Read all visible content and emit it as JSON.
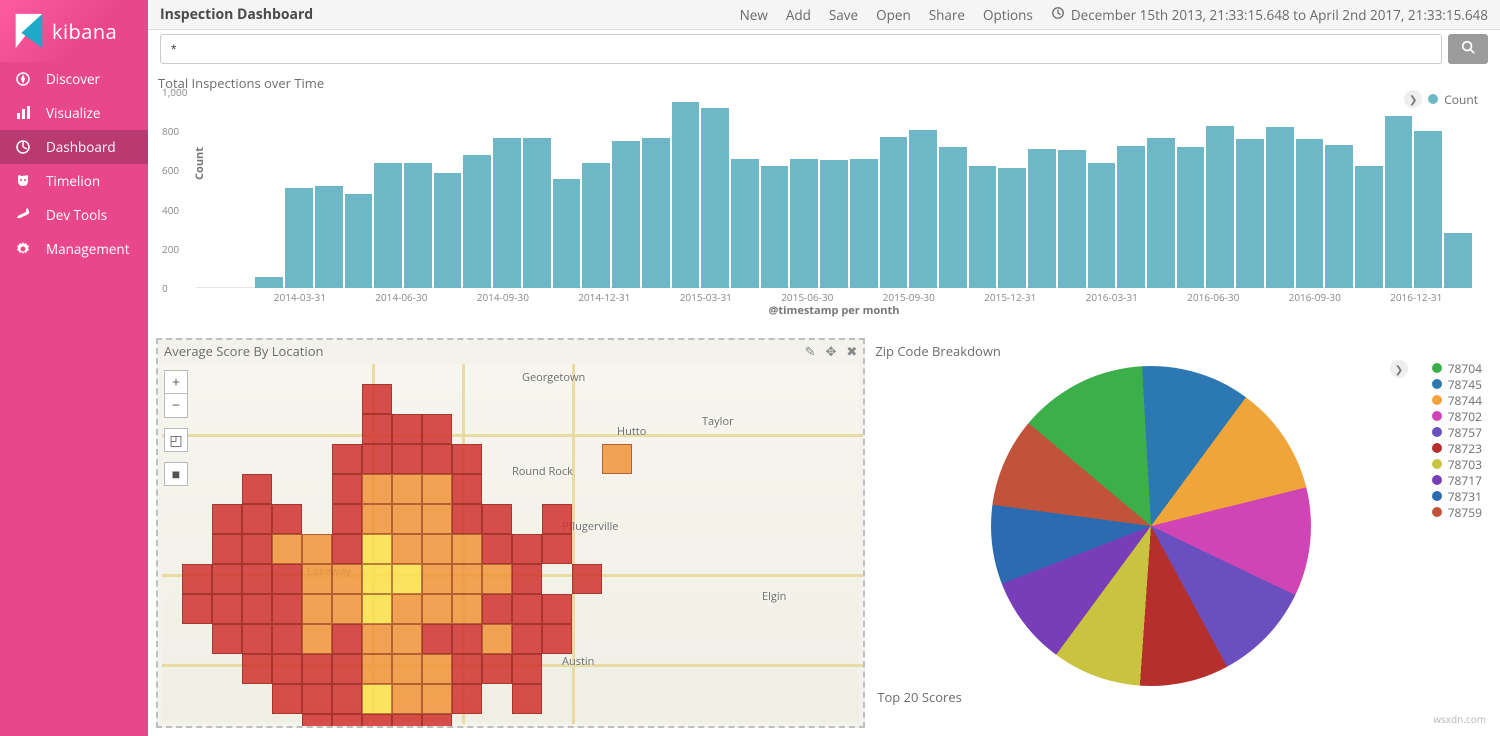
{
  "brand": "kibana",
  "nav": [
    {
      "label": "Discover",
      "active": false
    },
    {
      "label": "Visualize",
      "active": false
    },
    {
      "label": "Dashboard",
      "active": true
    },
    {
      "label": "Timelion",
      "active": false
    },
    {
      "label": "Dev Tools",
      "active": false
    },
    {
      "label": "Management",
      "active": false
    }
  ],
  "topbar": {
    "title": "Inspection Dashboard",
    "actions": [
      "New",
      "Add",
      "Save",
      "Open",
      "Share",
      "Options"
    ],
    "timerange": "December 15th 2013, 21:33:15.648 to April 2nd 2017, 21:33:15.648"
  },
  "search": {
    "value": "*"
  },
  "panels": {
    "bar_title": "Total Inspections over Time",
    "bar_legend": "Count",
    "map_title": "Average Score By Location",
    "pie_title": "Zip Code Breakdown",
    "scores_title": "Top 20 Scores"
  },
  "map_labels": [
    "Georgetown",
    "Round Rock",
    "Hutto",
    "Taylor",
    "Pflugerville",
    "Elgin",
    "Lakeway",
    "Austin"
  ],
  "pie_legend": [
    {
      "label": "78704",
      "color": "#3caf4a"
    },
    {
      "label": "78745",
      "color": "#2b78b3"
    },
    {
      "label": "78744",
      "color": "#f0a53a"
    },
    {
      "label": "78702",
      "color": "#d045b5"
    },
    {
      "label": "78757",
      "color": "#6a4fbf"
    },
    {
      "label": "78723",
      "color": "#b5302d"
    },
    {
      "label": "78703",
      "color": "#c9c33f"
    },
    {
      "label": "78717",
      "color": "#7a3db8"
    },
    {
      "label": "78731",
      "color": "#2d6bb0"
    },
    {
      "label": "78759",
      "color": "#c1533a"
    }
  ],
  "watermark": "wsxdn.com",
  "chart_data": [
    {
      "type": "bar",
      "title": "Total Inspections over Time",
      "xlabel": "@timestamp per month",
      "ylabel": "Count",
      "ylim": [
        0,
        1000
      ],
      "yticks": [
        0,
        200,
        400,
        600,
        800,
        "1,000"
      ],
      "xticks": [
        "2014-03-31",
        "2014-06-30",
        "2014-09-30",
        "2014-12-31",
        "2015-03-31",
        "2015-06-30",
        "2015-09-30",
        "2015-12-31",
        "2016-03-31",
        "2016-06-30",
        "2016-09-30",
        "2016-12-31"
      ],
      "series": [
        {
          "name": "Count",
          "color": "#6db7c6",
          "values": [
            0,
            0,
            55,
            510,
            520,
            480,
            640,
            640,
            585,
            680,
            765,
            765,
            555,
            640,
            750,
            765,
            950,
            920,
            660,
            620,
            660,
            655,
            660,
            770,
            805,
            720,
            625,
            610,
            710,
            705,
            640,
            725,
            765,
            720,
            825,
            760,
            820,
            760,
            730,
            625,
            880,
            800,
            280
          ]
        }
      ]
    },
    {
      "type": "pie",
      "title": "Zip Code Breakdown",
      "series": [
        {
          "name": "78704",
          "value": 13,
          "color": "#3caf4a"
        },
        {
          "name": "78745",
          "value": 11,
          "color": "#2b78b3"
        },
        {
          "name": "78744",
          "value": 11,
          "color": "#f0a53a"
        },
        {
          "name": "78702",
          "value": 11,
          "color": "#d045b5"
        },
        {
          "name": "78757",
          "value": 10,
          "color": "#6a4fbf"
        },
        {
          "name": "78723",
          "value": 9,
          "color": "#b5302d"
        },
        {
          "name": "78703",
          "value": 9,
          "color": "#c9c33f"
        },
        {
          "name": "78717",
          "value": 9,
          "color": "#7a3db8"
        },
        {
          "name": "78731",
          "value": 8,
          "color": "#2d6bb0"
        },
        {
          "name": "78759",
          "value": 9,
          "color": "#c1533a"
        }
      ]
    }
  ]
}
